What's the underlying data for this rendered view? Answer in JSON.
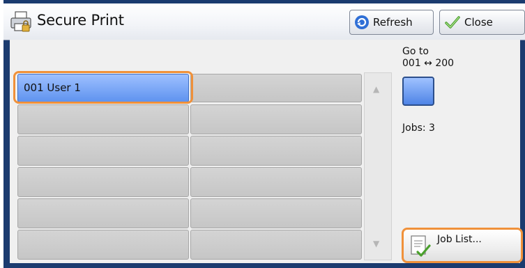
{
  "header": {
    "title": "Secure Print",
    "refresh_label": "Refresh",
    "close_label": "Close"
  },
  "users": {
    "selected_item": "001  User 1"
  },
  "side": {
    "goto_label": "Go to",
    "goto_range": "001 ↔ 200",
    "jobs_label": "Jobs: 3",
    "joblist_label": "Job List..."
  },
  "colors": {
    "accent_highlight": "#f0913a",
    "selected_blue": "#5f93ef",
    "frame_navy": "#1b3b6f"
  },
  "icons": {
    "title": "printer-lock-icon",
    "refresh": "refresh-icon",
    "close": "checkmark-icon",
    "scroll_up": "scroll-up-arrow-icon",
    "scroll_down": "scroll-down-arrow-icon",
    "joblist": "document-check-icon"
  }
}
